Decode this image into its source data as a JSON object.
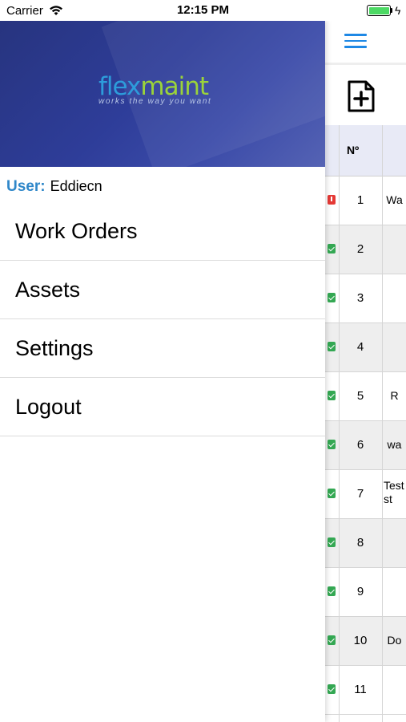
{
  "status_bar": {
    "carrier": "Carrier",
    "time": "12:15 PM"
  },
  "drawer": {
    "logo": {
      "part1": "flex",
      "part2": "maint",
      "tagline": "works the way you want"
    },
    "user": {
      "label": "User:",
      "name": "Eddiecn"
    },
    "menu": [
      {
        "label": "Work Orders"
      },
      {
        "label": "Assets"
      },
      {
        "label": "Settings"
      },
      {
        "label": "Logout"
      }
    ]
  },
  "background_screen": {
    "table": {
      "header_no": "Nº",
      "rows": [
        {
          "no": "1",
          "desc": "Wa",
          "status": "alert"
        },
        {
          "no": "2",
          "desc": "",
          "status": "ok"
        },
        {
          "no": "3",
          "desc": "",
          "status": "ok"
        },
        {
          "no": "4",
          "desc": "",
          "status": "ok"
        },
        {
          "no": "5",
          "desc": "R",
          "status": "ok"
        },
        {
          "no": "6",
          "desc": "wa",
          "status": "ok"
        },
        {
          "no": "7",
          "desc": "Testst",
          "status": "ok"
        },
        {
          "no": "8",
          "desc": "",
          "status": "ok"
        },
        {
          "no": "9",
          "desc": "",
          "status": "ok"
        },
        {
          "no": "10",
          "desc": "Do",
          "status": "ok"
        },
        {
          "no": "11",
          "desc": "",
          "status": "ok"
        }
      ]
    }
  },
  "colors": {
    "banner": "#2e3d99",
    "user_label": "#2f87c9",
    "logo_flex": "#2d9cdb",
    "logo_maint": "#9bd33a",
    "hamburger": "#1e88e5",
    "status_ok": "#34a853",
    "status_alert": "#e53935"
  }
}
